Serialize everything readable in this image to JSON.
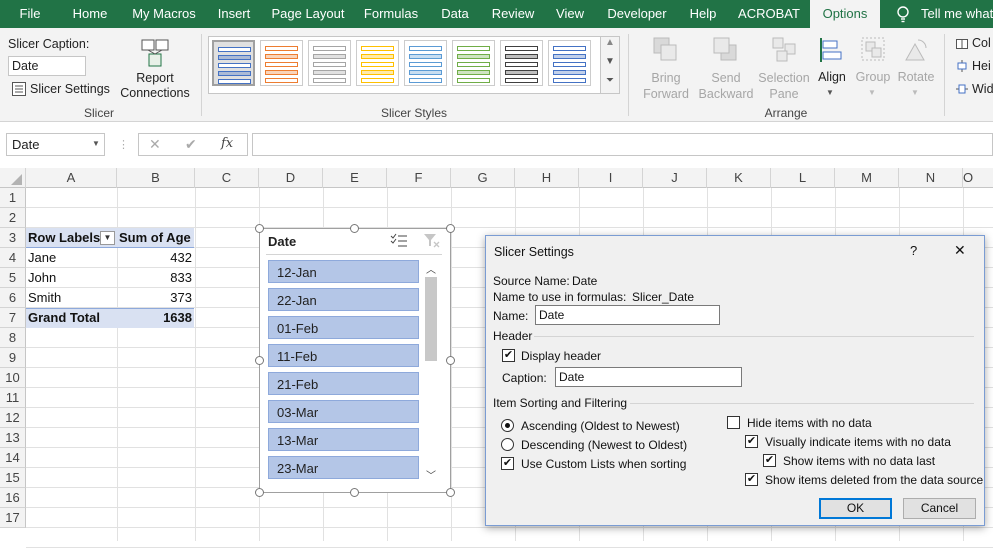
{
  "tabs": [
    "File",
    "Home",
    "My Macros",
    "Insert",
    "Page Layout",
    "Formulas",
    "Data",
    "Review",
    "View",
    "Developer",
    "Help",
    "ACROBAT",
    "Options"
  ],
  "tell_me": "Tell me what",
  "ribbon": {
    "slicer_caption_label": "Slicer Caption:",
    "slicer_caption_value": "Date",
    "slicer_settings": "Slicer Settings",
    "report_connections_1": "Report",
    "report_connections_2": "Connections",
    "group_slicer": "Slicer",
    "group_styles": "Slicer Styles",
    "bring_forward_1": "Bring",
    "bring_forward_2": "Forward",
    "send_backward_1": "Send",
    "send_backward_2": "Backward",
    "selection_pane_1": "Selection",
    "selection_pane_2": "Pane",
    "align": "Align",
    "group": "Group",
    "rotate": "Rotate",
    "group_arrange": "Arrange",
    "col": "Col",
    "hei": "Hei",
    "wid": "Wid",
    "style_colors": [
      "#4472c4",
      "#ed7d31",
      "#a5a5a5",
      "#ffc000",
      "#5b9bd5",
      "#70ad47",
      "#404040",
      "#4472c4"
    ]
  },
  "namebox": "Date",
  "fx": "fx",
  "columns": [
    "A",
    "B",
    "C",
    "D",
    "E",
    "F",
    "G",
    "H",
    "I",
    "J",
    "K",
    "L",
    "M",
    "N",
    "O"
  ],
  "rows": [
    "1",
    "2",
    "3",
    "4",
    "5",
    "6",
    "7",
    "8",
    "9",
    "10",
    "11",
    "12",
    "13",
    "14",
    "15",
    "16",
    "17"
  ],
  "pivot": {
    "header_a": "Row Labels",
    "header_b": "Sum of Age",
    "r1a": "Jane",
    "r1b": "432",
    "r2a": "John",
    "r2b": "833",
    "r3a": "Smith",
    "r3b": "373",
    "total_a": "Grand Total",
    "total_b": "1638"
  },
  "slicer": {
    "title": "Date",
    "items": [
      "12-Jan",
      "22-Jan",
      "01-Feb",
      "11-Feb",
      "21-Feb",
      "03-Mar",
      "13-Mar",
      "23-Mar"
    ]
  },
  "dialog": {
    "title": "Slicer Settings",
    "help": "?",
    "close": "✕",
    "source_label": "Source Name:",
    "source_value": "Date",
    "formula_label": "Name to use in formulas:",
    "formula_value": "Slicer_Date",
    "name_label": "Name:",
    "name_value": "Date",
    "header_section": "Header",
    "display_header": "Display header",
    "caption_label": "Caption:",
    "caption_value": "Date",
    "sorting_section": "Item Sorting and Filtering",
    "ascending": "Ascending (Oldest to Newest)",
    "descending": "Descending (Newest to Oldest)",
    "custom_lists": "Use Custom Lists when sorting",
    "hide_items": "Hide items with no data",
    "visually_indicate": "Visually indicate items with no data",
    "show_last": "Show items with no data last",
    "show_deleted": "Show items deleted from the data source",
    "ok": "OK",
    "cancel": "Cancel"
  }
}
